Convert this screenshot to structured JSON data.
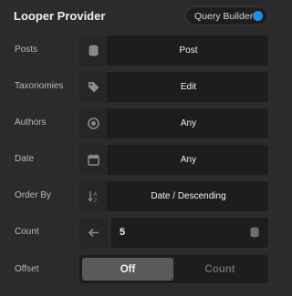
{
  "header": {
    "title": "Looper Provider",
    "query_builder_label": "Query Builder",
    "query_builder_on": true,
    "accent": "#1e90e8"
  },
  "rows": {
    "posts": {
      "label": "Posts",
      "value": "Post",
      "icon": "database-icon"
    },
    "taxonomies": {
      "label": "Taxonomies",
      "value": "Edit",
      "icon": "tag-icon"
    },
    "authors": {
      "label": "Authors",
      "value": "Any",
      "icon": "user-circle-icon"
    },
    "date": {
      "label": "Date",
      "value": "Any",
      "icon": "calendar-icon"
    },
    "order_by": {
      "label": "Order By",
      "value": "Date / Descending",
      "icon": "sort-icon"
    },
    "count": {
      "label": "Count",
      "value": "5",
      "icon": "arrow-left-icon",
      "trailing_icon": "database-icon"
    },
    "offset": {
      "label": "Offset",
      "options": [
        "Off",
        "Count"
      ],
      "selected": "Off"
    }
  }
}
